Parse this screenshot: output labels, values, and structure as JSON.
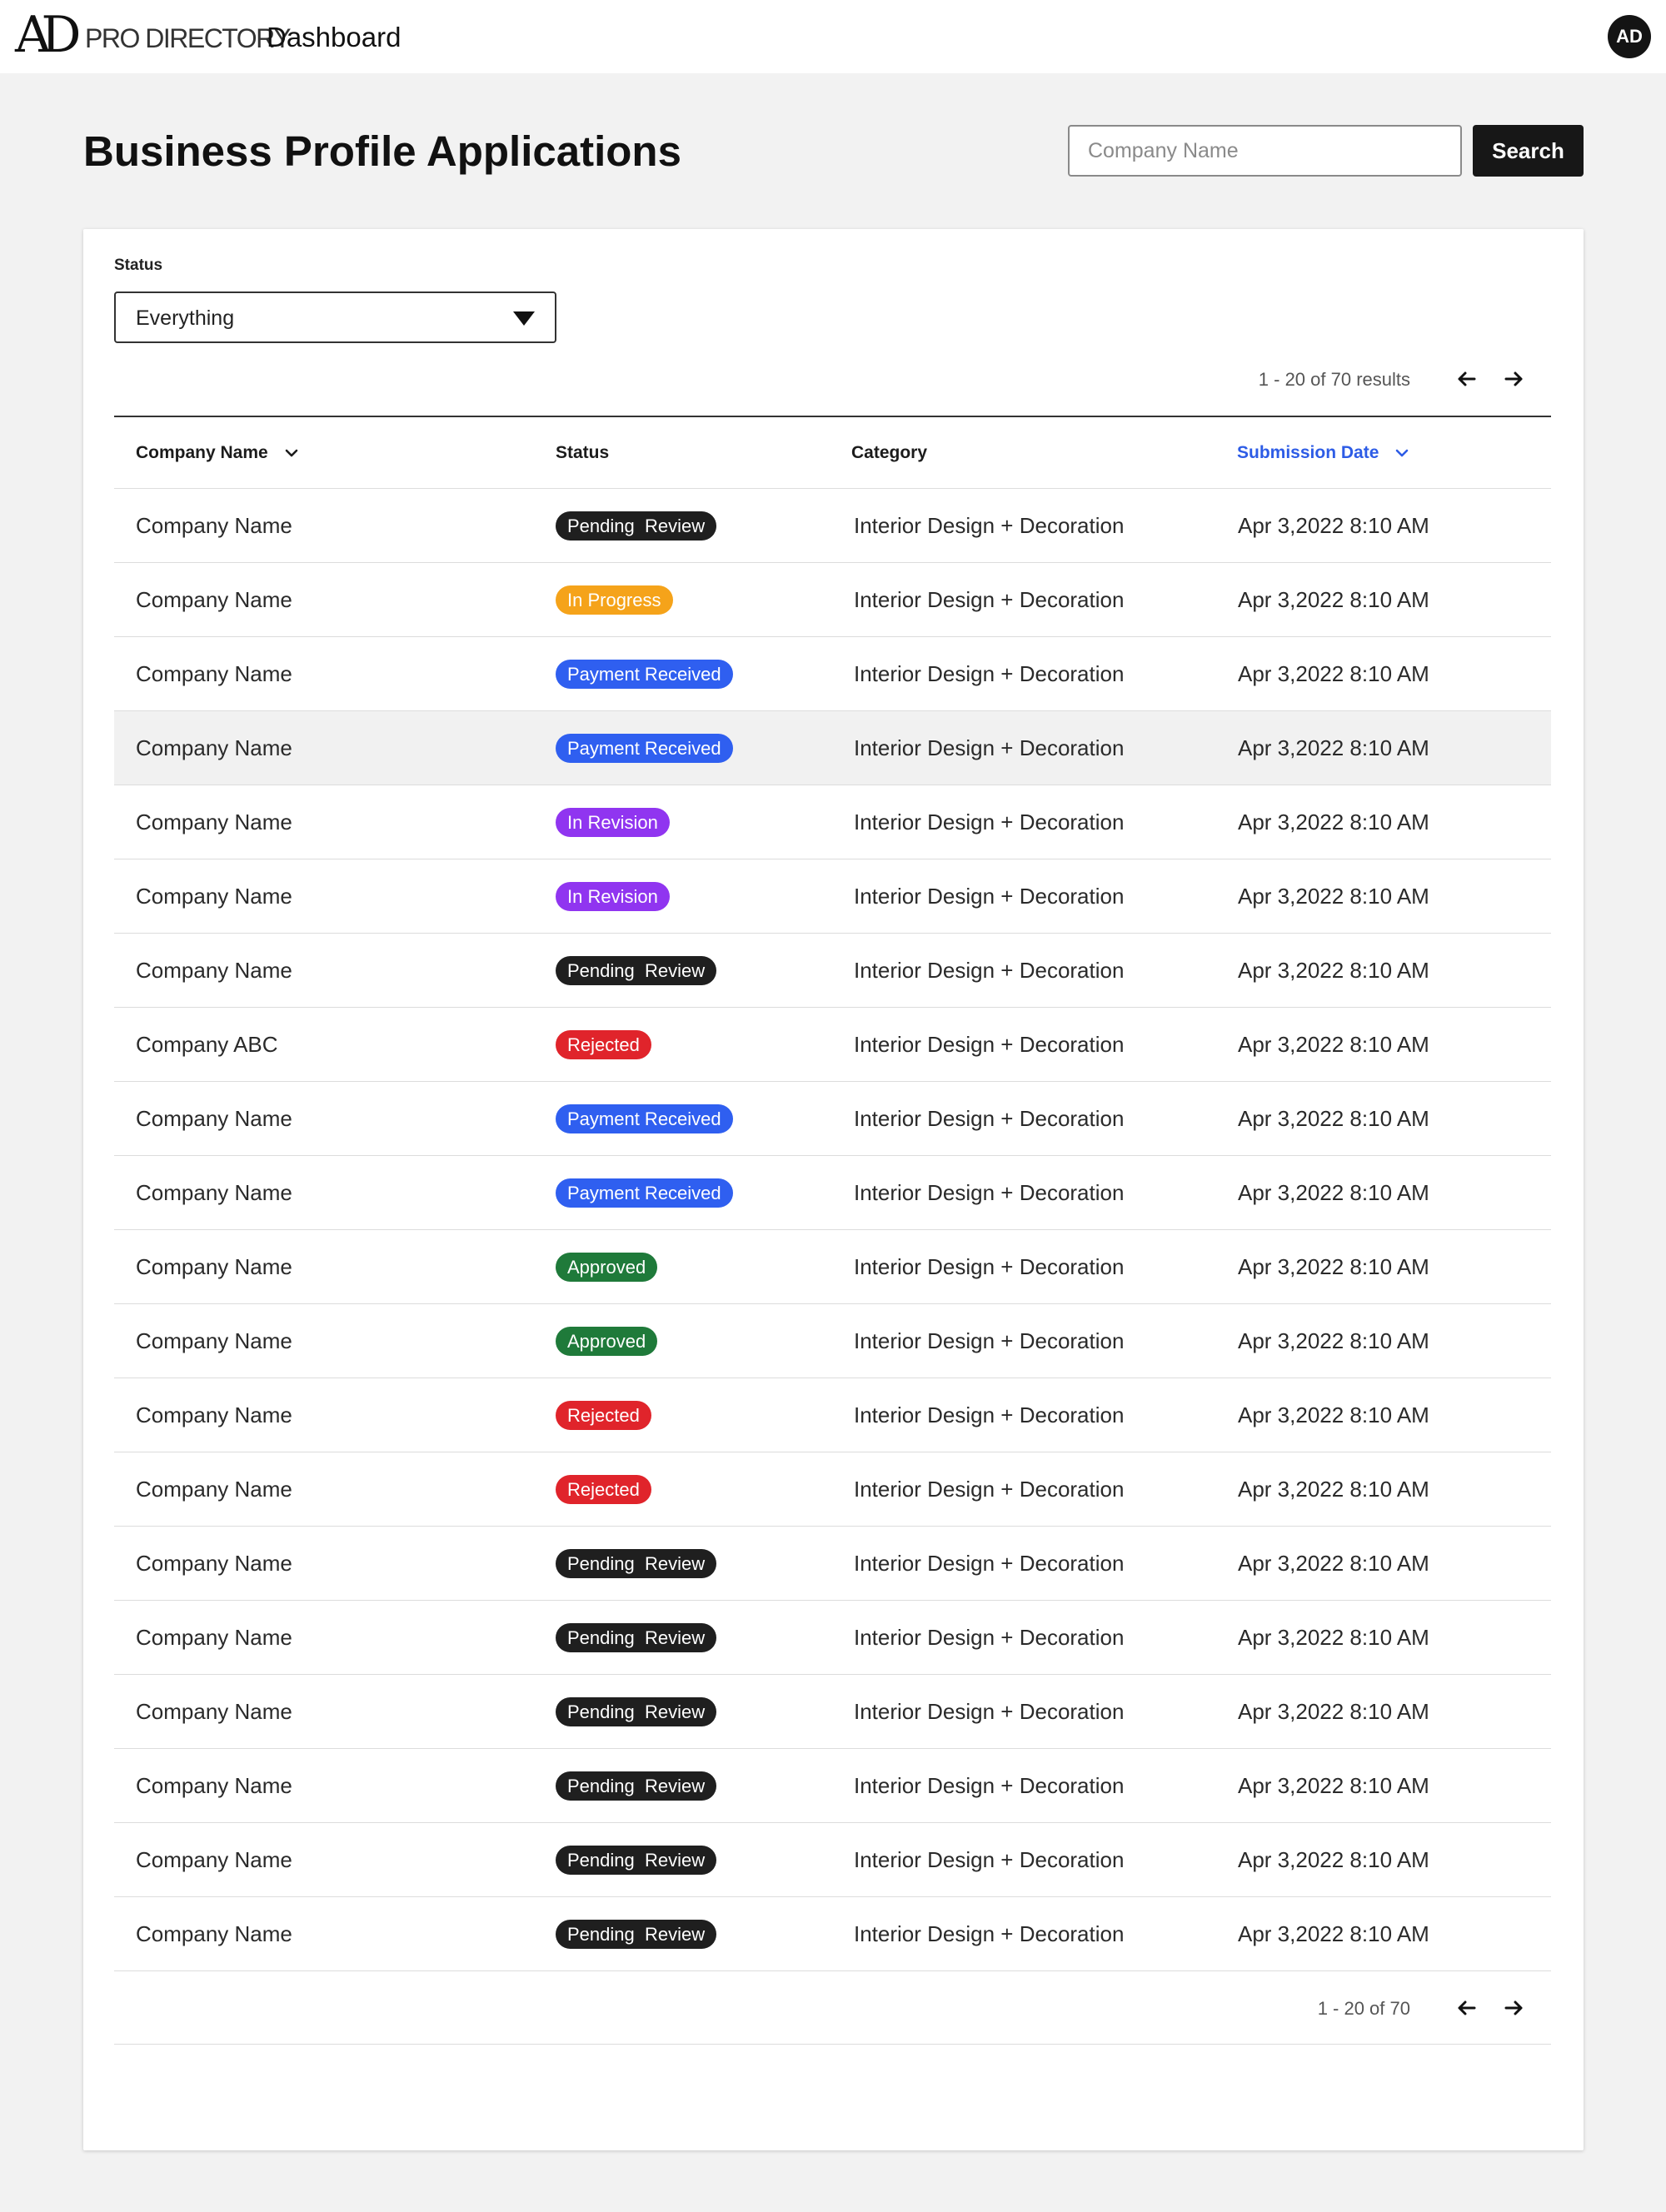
{
  "app": {
    "logo_mark": "AD",
    "logo_sub": "PRO DIRECTORY",
    "section": "Dashboard",
    "avatar_initials": "AD"
  },
  "header": {
    "title": "Business Profile Applications",
    "search_placeholder": "Company Name",
    "search_button": "Search"
  },
  "filter": {
    "status_label": "Status",
    "status_value": "Everything"
  },
  "pagination": {
    "top_text": "1 - 20 of 70 results",
    "bottom_text": "1 - 20 of 70"
  },
  "table": {
    "columns": [
      "Company Name",
      "Status",
      "Category",
      "Submission Date"
    ],
    "rows": [
      {
        "company": "Company Name",
        "status": "Pending  Review",
        "category": "Interior Design + Decoration",
        "date": "Apr 3,2022 8:10 AM"
      },
      {
        "company": "Company Name",
        "status": "In Progress",
        "category": "Interior Design + Decoration",
        "date": "Apr 3,2022 8:10 AM"
      },
      {
        "company": "Company Name",
        "status": "Payment Received",
        "category": "Interior Design + Decoration",
        "date": "Apr 3,2022 8:10 AM"
      },
      {
        "company": "Company Name",
        "status": "Payment Received",
        "category": "Interior Design + Decoration",
        "date": "Apr 3,2022 8:10 AM"
      },
      {
        "company": "Company Name",
        "status": "In Revision",
        "category": "Interior Design + Decoration",
        "date": "Apr 3,2022 8:10 AM"
      },
      {
        "company": "Company Name",
        "status": "In Revision",
        "category": "Interior Design + Decoration",
        "date": "Apr 3,2022 8:10 AM"
      },
      {
        "company": "Company Name",
        "status": "Pending  Review",
        "category": "Interior Design + Decoration",
        "date": "Apr 3,2022 8:10 AM"
      },
      {
        "company": "Company ABC",
        "status": "Rejected",
        "category": "Interior Design + Decoration",
        "date": "Apr 3,2022 8:10 AM"
      },
      {
        "company": "Company Name",
        "status": "Payment Received",
        "category": "Interior Design + Decoration",
        "date": "Apr 3,2022 8:10 AM"
      },
      {
        "company": "Company Name",
        "status": "Payment Received",
        "category": "Interior Design + Decoration",
        "date": "Apr 3,2022 8:10 AM"
      },
      {
        "company": "Company Name",
        "status": "Approved",
        "category": "Interior Design + Decoration",
        "date": "Apr 3,2022 8:10 AM"
      },
      {
        "company": "Company Name",
        "status": "Approved",
        "category": "Interior Design + Decoration",
        "date": "Apr 3,2022 8:10 AM"
      },
      {
        "company": "Company Name",
        "status": "Rejected",
        "category": "Interior Design + Decoration",
        "date": "Apr 3,2022 8:10 AM"
      },
      {
        "company": "Company Name",
        "status": "Rejected",
        "category": "Interior Design + Decoration",
        "date": "Apr 3,2022 8:10 AM"
      },
      {
        "company": "Company Name",
        "status": "Pending  Review",
        "category": "Interior Design + Decoration",
        "date": "Apr 3,2022 8:10 AM"
      },
      {
        "company": "Company Name",
        "status": "Pending  Review",
        "category": "Interior Design + Decoration",
        "date": "Apr 3,2022 8:10 AM"
      },
      {
        "company": "Company Name",
        "status": "Pending  Review",
        "category": "Interior Design + Decoration",
        "date": "Apr 3,2022 8:10 AM"
      },
      {
        "company": "Company Name",
        "status": "Pending  Review",
        "category": "Interior Design + Decoration",
        "date": "Apr 3,2022 8:10 AM"
      },
      {
        "company": "Company Name",
        "status": "Pending  Review",
        "category": "Interior Design + Decoration",
        "date": "Apr 3,2022 8:10 AM"
      },
      {
        "company": "Company Name",
        "status": "Pending  Review",
        "category": "Interior Design + Decoration",
        "date": "Apr 3,2022 8:10 AM"
      }
    ]
  },
  "status_colors": {
    "Pending  Review": "#1f1f1f",
    "In Progress": "#f5a31a",
    "Payment Received": "#2f5ff0",
    "In Revision": "#9035f0",
    "Rejected": "#e0242b",
    "Approved": "#1f7a3a"
  },
  "icons": {
    "sort": "chevron-down-icon",
    "prev": "arrow-left-icon",
    "next": "arrow-right-icon",
    "select": "caret-down-icon"
  },
  "accent_color": "#2d5ce6"
}
